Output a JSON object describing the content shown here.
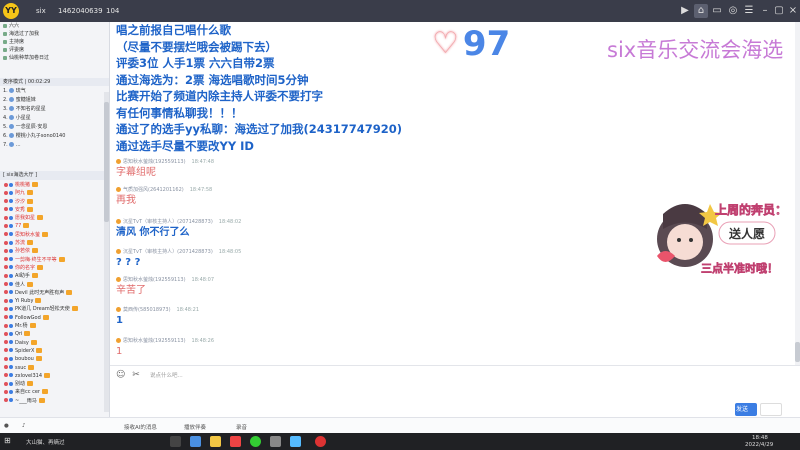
{
  "titlebar": {
    "app_name": "six",
    "channel_id": "1462040639",
    "member_count": "104"
  },
  "sidebar": {
    "channels": [
      {
        "label": "六六"
      },
      {
        "label": "海选过了加我"
      },
      {
        "label": "主持席"
      },
      {
        "label": "评委席"
      },
      {
        "label": "仙桃种草加卷日过"
      }
    ],
    "queue_header": "麦序模式 | 00:02:29",
    "queue": [
      {
        "num": "1.",
        "label": "琉气"
      },
      {
        "num": "2.",
        "label": "蜜糖姐妹"
      },
      {
        "num": "3.",
        "label": "不知名的星星"
      },
      {
        "num": "4.",
        "label": "小星星"
      },
      {
        "num": "5.",
        "label": "一念星辰·安恩"
      },
      {
        "num": "6.",
        "label": "樱桃小丸子sono0140"
      },
      {
        "num": "7.",
        "label": "..."
      }
    ],
    "members_header": "[ six海选大厅 ]",
    "members": [
      {
        "label": "桃桃猪"
      },
      {
        "label": "阿九"
      },
      {
        "label": "汐汐"
      },
      {
        "label": "安秀"
      },
      {
        "label": "愿我如星"
      },
      {
        "label": "77"
      },
      {
        "label": "思知秋水萤"
      },
      {
        "label": "苏流"
      },
      {
        "label": "孙若依"
      },
      {
        "label": "一剪梅·终生不平等"
      },
      {
        "label": "你的名字"
      },
      {
        "label": "AI助手"
      },
      {
        "label": "佳人"
      },
      {
        "label": "Devil  此时无声胜有声"
      },
      {
        "label": "Yi  Ruby"
      },
      {
        "label": "PK道几  Dream轻松天使"
      },
      {
        "label": "FollowGod"
      },
      {
        "label": "Mr.杨"
      },
      {
        "label": "Qri"
      },
      {
        "label": "Daisy"
      },
      {
        "label": "SpiderX"
      },
      {
        "label": "boubou"
      },
      {
        "label": "ssuc"
      },
      {
        "label": "zxlovel314"
      },
      {
        "label": "别动"
      },
      {
        "label": "来自cc cer"
      },
      {
        "label": "~___雨马"
      }
    ]
  },
  "announcement": [
    "唱之前报自己唱什么歌",
    "（尽量不要摆烂哦会被踢下去）",
    "评委3位 人手1票 六六自带2票",
    "通过海选为：2票 海选唱歌时间5分钟",
    "比赛开始了频道内除主持人评委不要打字",
    "有任何事情私聊我！！！",
    "通过了的选手yy私聊：海选过了加我(2431774792​0)",
    "通过选手尽量不要改YY ID"
  ],
  "score": "97",
  "banner": "six音乐交流会海选",
  "messages": [
    {
      "name": "思知秋水萤烛(192559113)",
      "time": "18:47:48",
      "text": "字幕组呢",
      "color": "#e06b6b"
    },
    {
      "name": "气质加强风(2641201162)",
      "time": "18:47:58",
      "text": "再我",
      "color": "#e06b6b"
    },
    {
      "name": "沉星TvT（审核主持人）(2071428873)",
      "time": "18:48:02",
      "text": "清风 你不行了么",
      "color": "#1e63c8"
    },
    {
      "name": "沉星TvT（审核主持人）(2071428873)",
      "time": "18:48:05",
      "text": "? ? ?",
      "color": "#1e63c8"
    },
    {
      "name": "思知秋水萤烛(192559113)",
      "time": "18:48:07",
      "text": "辛苦了",
      "color": "#e06b6b"
    },
    {
      "name": "莫西传(585018973)",
      "time": "18:48:21",
      "text": "1",
      "color": "#1e63c8"
    },
    {
      "name": "思知秋水萤烛(192559113)",
      "time": "18:48:26",
      "text": "1",
      "color": "#e06b6b"
    }
  ],
  "input": {
    "placeholder": "说点什么吧..."
  },
  "buttons": {
    "send": "发送"
  },
  "sticker": {
    "line1": "上周的奔员：",
    "line2": "送人愿",
    "line3": "三点半准时哦！"
  },
  "statusbar": {
    "item1": "接收AI的消息",
    "item2": "播放伴奏",
    "item3": "录音"
  },
  "taskbar": {
    "search": "大山猫、再熵过",
    "time": "18:48",
    "date": "2022/4/29"
  },
  "colors": {
    "announce": "#1e63c8",
    "banner": "#c77ad6",
    "score": "#4b86e6"
  }
}
